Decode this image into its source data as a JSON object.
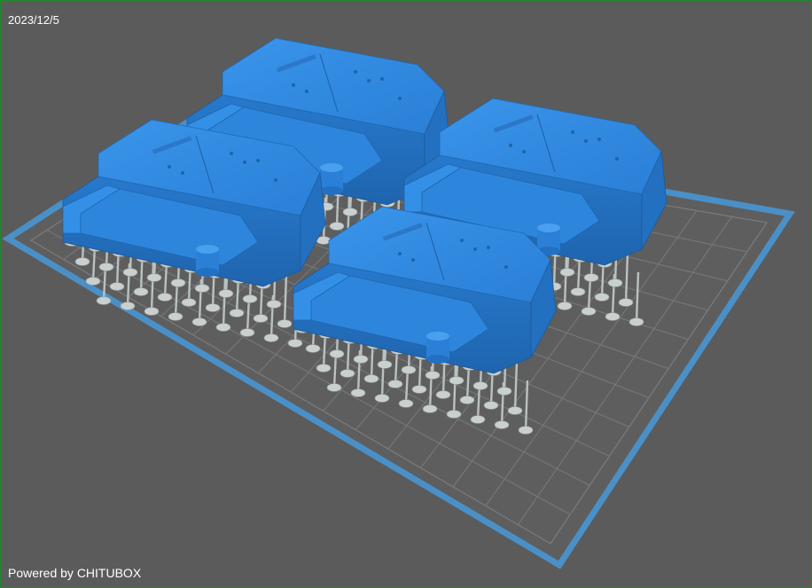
{
  "overlay": {
    "date": "2023/12/5",
    "powered_by": "Powered by CHITUBOX"
  },
  "scene": {
    "background": "#5b5b5b",
    "plate_border_color": "#4a90c8",
    "grid_color": "#767676",
    "model_color": "#2f8ae0",
    "support_color": "#c9d0cf",
    "model_count": 4,
    "model_name_icon": "blue-3d-print-part-icon",
    "support_icon": "support-pillar-icon"
  }
}
